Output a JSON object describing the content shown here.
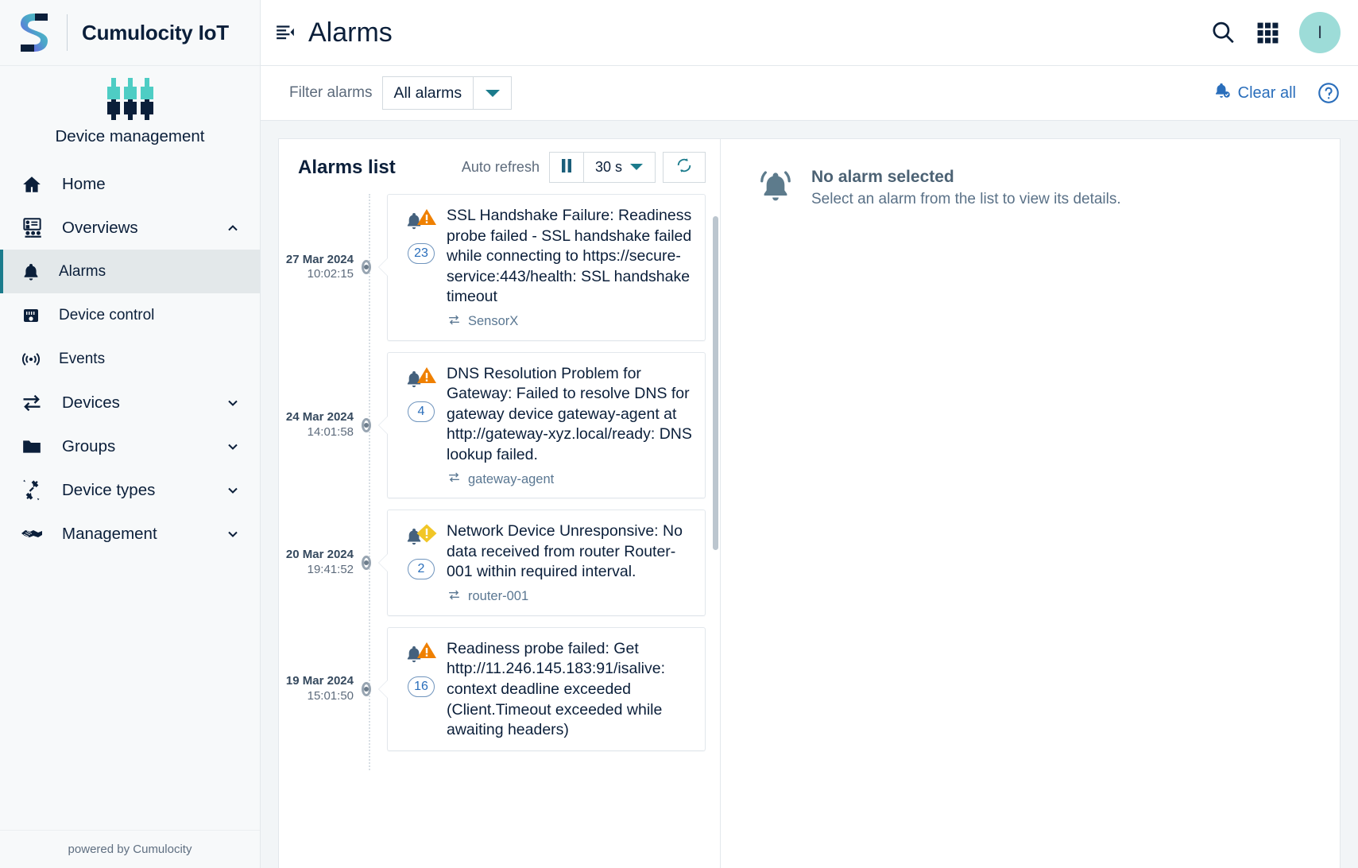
{
  "brand": {
    "title": "Cumulocity IoT",
    "app_name": "Device management",
    "footer": "powered by Cumulocity"
  },
  "sidebar": {
    "items": [
      {
        "label": "Home",
        "icon": "home-icon",
        "level": "top",
        "chevron": "",
        "active": false
      },
      {
        "label": "Overviews",
        "icon": "overviews-icon",
        "level": "top",
        "chevron": "up",
        "active": false
      },
      {
        "label": "Alarms",
        "icon": "bell-icon",
        "level": "sub",
        "chevron": "",
        "active": true
      },
      {
        "label": "Device control",
        "icon": "device-control-icon",
        "level": "sub",
        "chevron": "",
        "active": false
      },
      {
        "label": "Events",
        "icon": "events-icon",
        "level": "sub",
        "chevron": "",
        "active": false
      },
      {
        "label": "Devices",
        "icon": "devices-icon",
        "level": "top",
        "chevron": "down",
        "active": false
      },
      {
        "label": "Groups",
        "icon": "folder-icon",
        "level": "top",
        "chevron": "down",
        "active": false
      },
      {
        "label": "Device types",
        "icon": "device-types-icon",
        "level": "top",
        "chevron": "down",
        "active": false
      },
      {
        "label": "Management",
        "icon": "handshake-icon",
        "level": "top",
        "chevron": "down",
        "active": false
      }
    ]
  },
  "topbar": {
    "title": "Alarms",
    "collapse_icon": "collapse-menu-icon",
    "search_icon": "search-icon",
    "apps_icon": "app-switcher-icon",
    "avatar_initial": "I"
  },
  "filterbar": {
    "label": "Filter alarms",
    "selected": "All alarms",
    "options": [
      "All alarms"
    ],
    "clear_all": "Clear all",
    "help_icon": "help-circle-icon"
  },
  "alarms_panel": {
    "title": "Alarms list",
    "auto_refresh_label": "Auto refresh",
    "pause_icon": "pause-icon",
    "interval": "30 s",
    "refresh_icon": "refresh-icon",
    "alarms": [
      {
        "date": "27 Mar 2024",
        "time": "10:02:15",
        "severity": "major",
        "severity_color": "#ef8000",
        "count": "23",
        "text": "SSL Handshake Failure: Readiness probe failed - SSL handshake failed while connecting to https://secure-service:443/health: SSL handshake timeout",
        "source": "SensorX"
      },
      {
        "date": "24 Mar 2024",
        "time": "14:01:58",
        "severity": "major",
        "severity_color": "#ef8000",
        "count": "4",
        "text": "DNS Resolution Problem for Gateway: Failed to resolve DNS for gateway device gateway-agent at http://gateway-xyz.local/ready: DNS lookup failed.",
        "source": "gateway-agent"
      },
      {
        "date": "20 Mar 2024",
        "time": "19:41:52",
        "severity": "minor",
        "severity_color": "#f1c627",
        "count": "2",
        "text": "Network Device Unresponsive: No data received from router Router-001 within required interval.",
        "source": "router-001"
      },
      {
        "date": "19 Mar 2024",
        "time": "15:01:50",
        "severity": "major",
        "severity_color": "#ef8000",
        "count": "16",
        "text": "Readiness probe failed: Get http://11.246.145.183:91/isalive: context deadline exceeded (Client.Timeout exceeded while awaiting headers)",
        "source": ""
      }
    ]
  },
  "detail_panel": {
    "icon": "bell-ringing-icon",
    "title": "No alarm selected",
    "subtitle": "Select an alarm from the list to view its details."
  },
  "colors": {
    "accent_teal": "#1b7b8c",
    "link_blue": "#2a6ebb",
    "navy": "#0b1f3a",
    "major_orange": "#ef8000",
    "minor_yellow": "#f1c627"
  }
}
